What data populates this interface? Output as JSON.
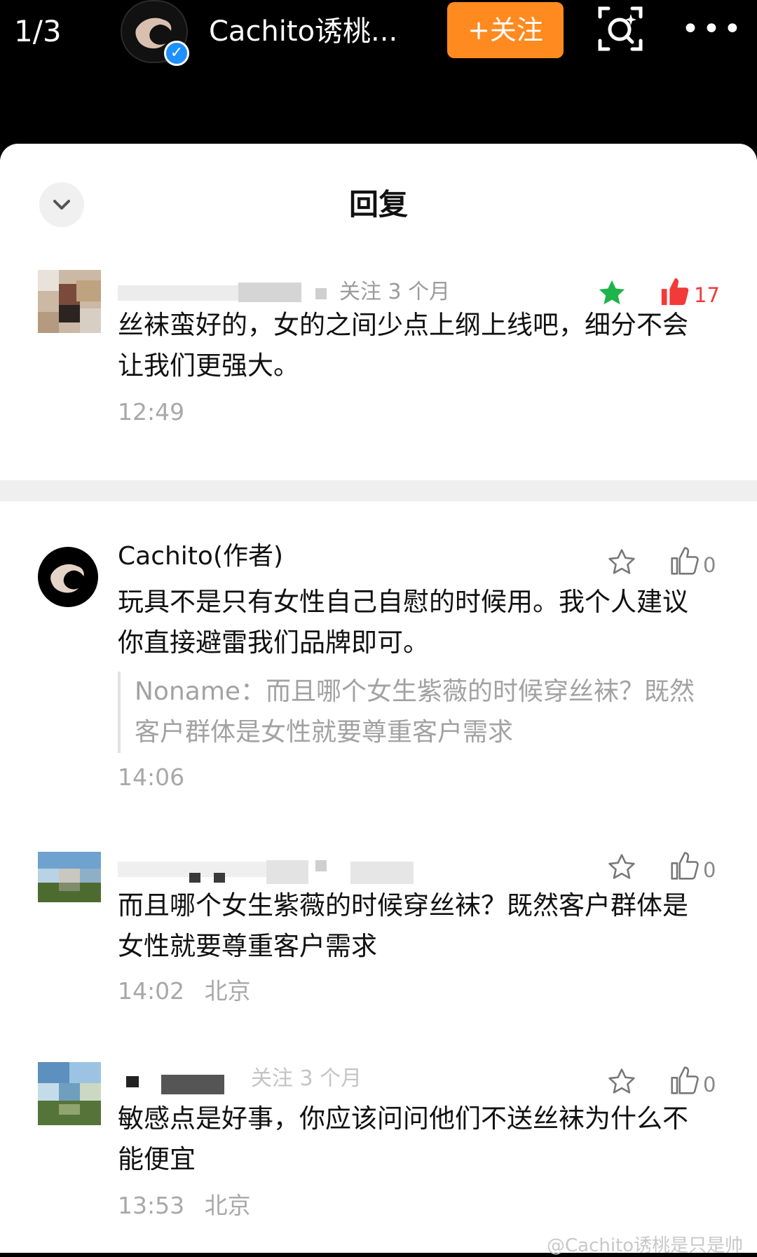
{
  "topbar": {
    "page_counter": "1/3",
    "account_name": "Cachito诱桃...",
    "follow_label": "+关注",
    "more_label": "•••"
  },
  "sheet": {
    "title": "回复"
  },
  "root_comment": {
    "meta": "关注 3 个月",
    "likes": "17",
    "text": "丝袜蛮好的，女的之间少点上纲上线吧，细分不会让我们更强大。",
    "time": "12:49"
  },
  "replies": [
    {
      "username": "Cachito(作者)",
      "text": "玩具不是只有女性自己自慰的时候用。我个人建议你直接避雷我们品牌即可。",
      "quote": "Noname：而且哪个女生紫薇的时候穿丝袜？既然客户群体是女性就要尊重客户需求",
      "time": "14:06",
      "likes": "0"
    },
    {
      "text": "而且哪个女生紫薇的时候穿丝袜？既然客户群体是女性就要尊重客户需求",
      "time": "14:02",
      "location": "北京",
      "likes": "0"
    },
    {
      "meta": "关注 3 个月",
      "text": "敏感点是好事，你应该问问他们不送丝袜为什么不能便宜",
      "time": "13:53",
      "location": "北京",
      "likes": "0"
    }
  ],
  "watermark": "@Cachito诱桃是只是帅",
  "colors": {
    "follow_button": "#ff8a1f",
    "verified_badge": "#1e90ff",
    "star_active": "#1fb34a",
    "like_active": "#f23a3a"
  },
  "icons": {
    "verified": "verified-check-icon",
    "scan": "scan-sparkle-icon",
    "collapse": "chevron-down-icon",
    "star": "star-icon",
    "like": "thumbs-up-icon"
  }
}
